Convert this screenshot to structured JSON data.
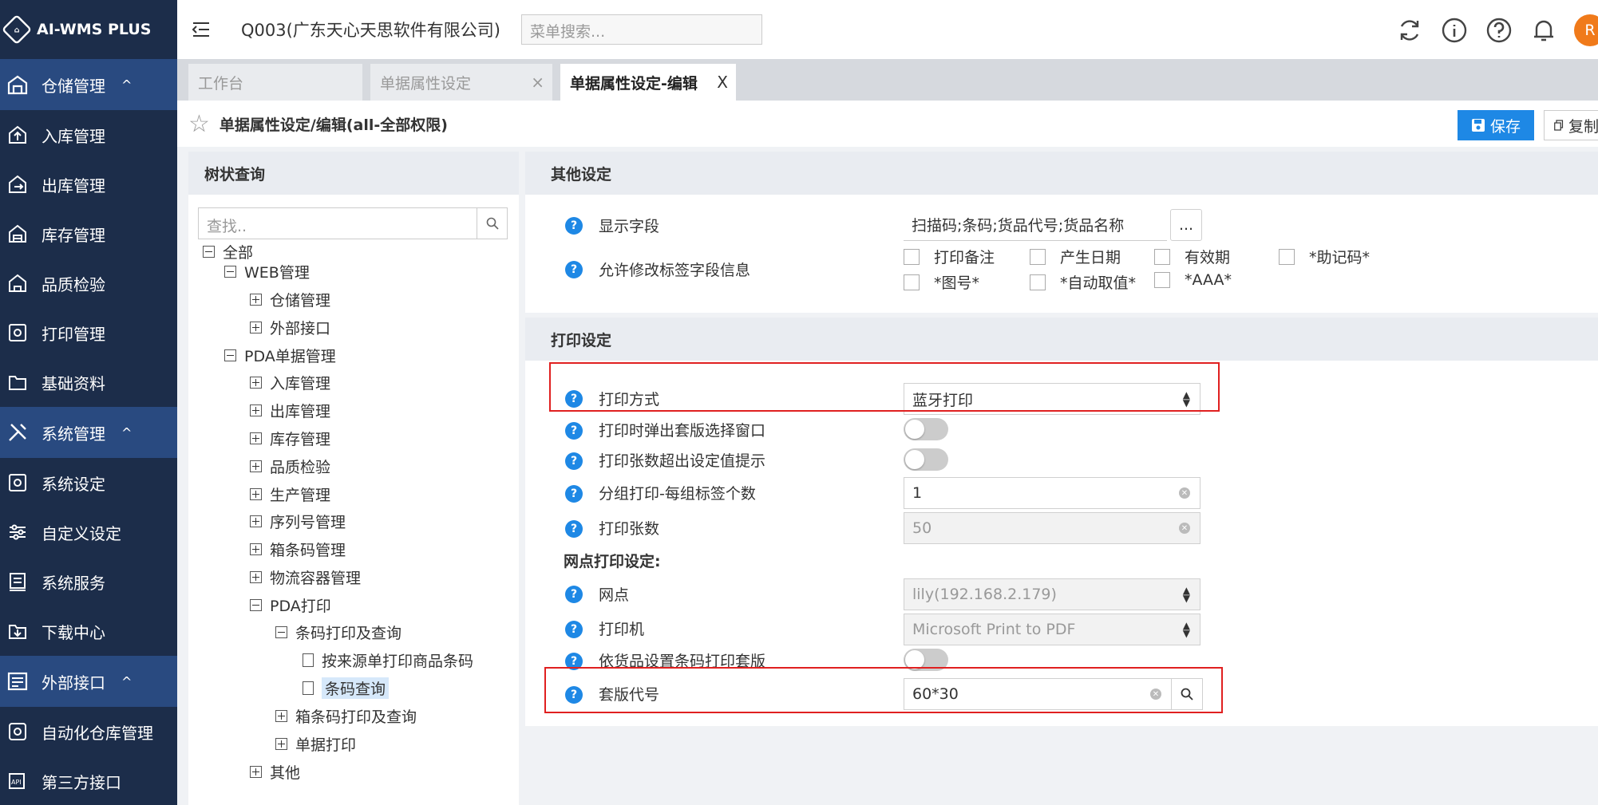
{
  "app": {
    "logo_text": "AI-WMS PLUS",
    "company": "Q003(广东天心天思软件有限公司)",
    "menu_search_placeholder": "菜单搜索...",
    "avatar_letter": "R"
  },
  "sidebar": {
    "groups": [
      {
        "label": "仓储管理",
        "items": [
          "入库管理",
          "出库管理",
          "库存管理",
          "品质检验",
          "打印管理",
          "基础资料"
        ]
      },
      {
        "label": "系统管理",
        "items": [
          "系统设定",
          "自定义设定",
          "系统服务",
          "下载中心"
        ]
      },
      {
        "label": "外部接口",
        "items": [
          "自动化仓库管理",
          "第三方接口"
        ]
      }
    ]
  },
  "tabs": [
    {
      "label": "工作台"
    },
    {
      "label": "单据属性设定",
      "close": "×"
    },
    {
      "label": "单据属性设定-编辑",
      "close": "X"
    }
  ],
  "page": {
    "title": "单据属性设定/编辑(all-全部权限)",
    "save_label": "保存",
    "copy_label": "复制"
  },
  "tree": {
    "header": "树状查询",
    "search_placeholder": "查找..",
    "nodes": [
      "全部",
      "WEB管理",
      "仓储管理",
      "外部接口",
      "PDA单据管理",
      "入库管理",
      "出库管理",
      "库存管理",
      "品质检验",
      "生产管理",
      "序列号管理",
      "箱条码管理",
      "物流容器管理",
      "PDA打印",
      "条码打印及查询",
      "按来源单打印商品条码",
      "条码查询",
      "箱条码打印及查询",
      "单据打印",
      "其他"
    ]
  },
  "other_settings": {
    "title": "其他设定",
    "display_fields_label": "显示字段",
    "display_fields_value": "扫描码;条码;货品代号;货品名称",
    "more_button": "...",
    "allow_edit_label": "允许修改标签字段信息",
    "checkboxes": [
      "打印备注",
      "产生日期",
      "有效期",
      "*助记码*",
      "*图号*",
      "*自动取值*",
      "*AAA*"
    ]
  },
  "print_settings": {
    "title": "打印设定",
    "print_mode_label": "打印方式",
    "print_mode_value": "蓝牙打印",
    "popup_template_label": "打印时弹出套版选择窗口",
    "exceed_prompt_label": "打印张数超出设定值提示",
    "group_count_label": "分组打印-每组标签个数",
    "group_count_value": "1",
    "print_copies_label": "打印张数",
    "print_copies_value": "50",
    "network_title": "网点打印设定:",
    "network_label": "网点",
    "network_value": "lily(192.168.2.179)",
    "printer_label": "打印机",
    "printer_value": "Microsoft Print to PDF",
    "by_goods_label": "依货品设置条码打印套版",
    "template_code_label": "套版代号",
    "template_code_value": "60*30"
  },
  "help_glyph": "?",
  "colors": {
    "sidebar_bg": "#1c2d4a",
    "sidebar_group_bg": "#294a80",
    "primary": "#1e88e5",
    "highlight_border": "#e02020",
    "avatar": "#f07a1a"
  },
  "icons": [
    "menu-fold-icon",
    "refresh-icon",
    "info-icon",
    "help-icon",
    "bell-icon",
    "user-icon",
    "star-icon",
    "save-icon",
    "copy-icon",
    "search-icon"
  ]
}
